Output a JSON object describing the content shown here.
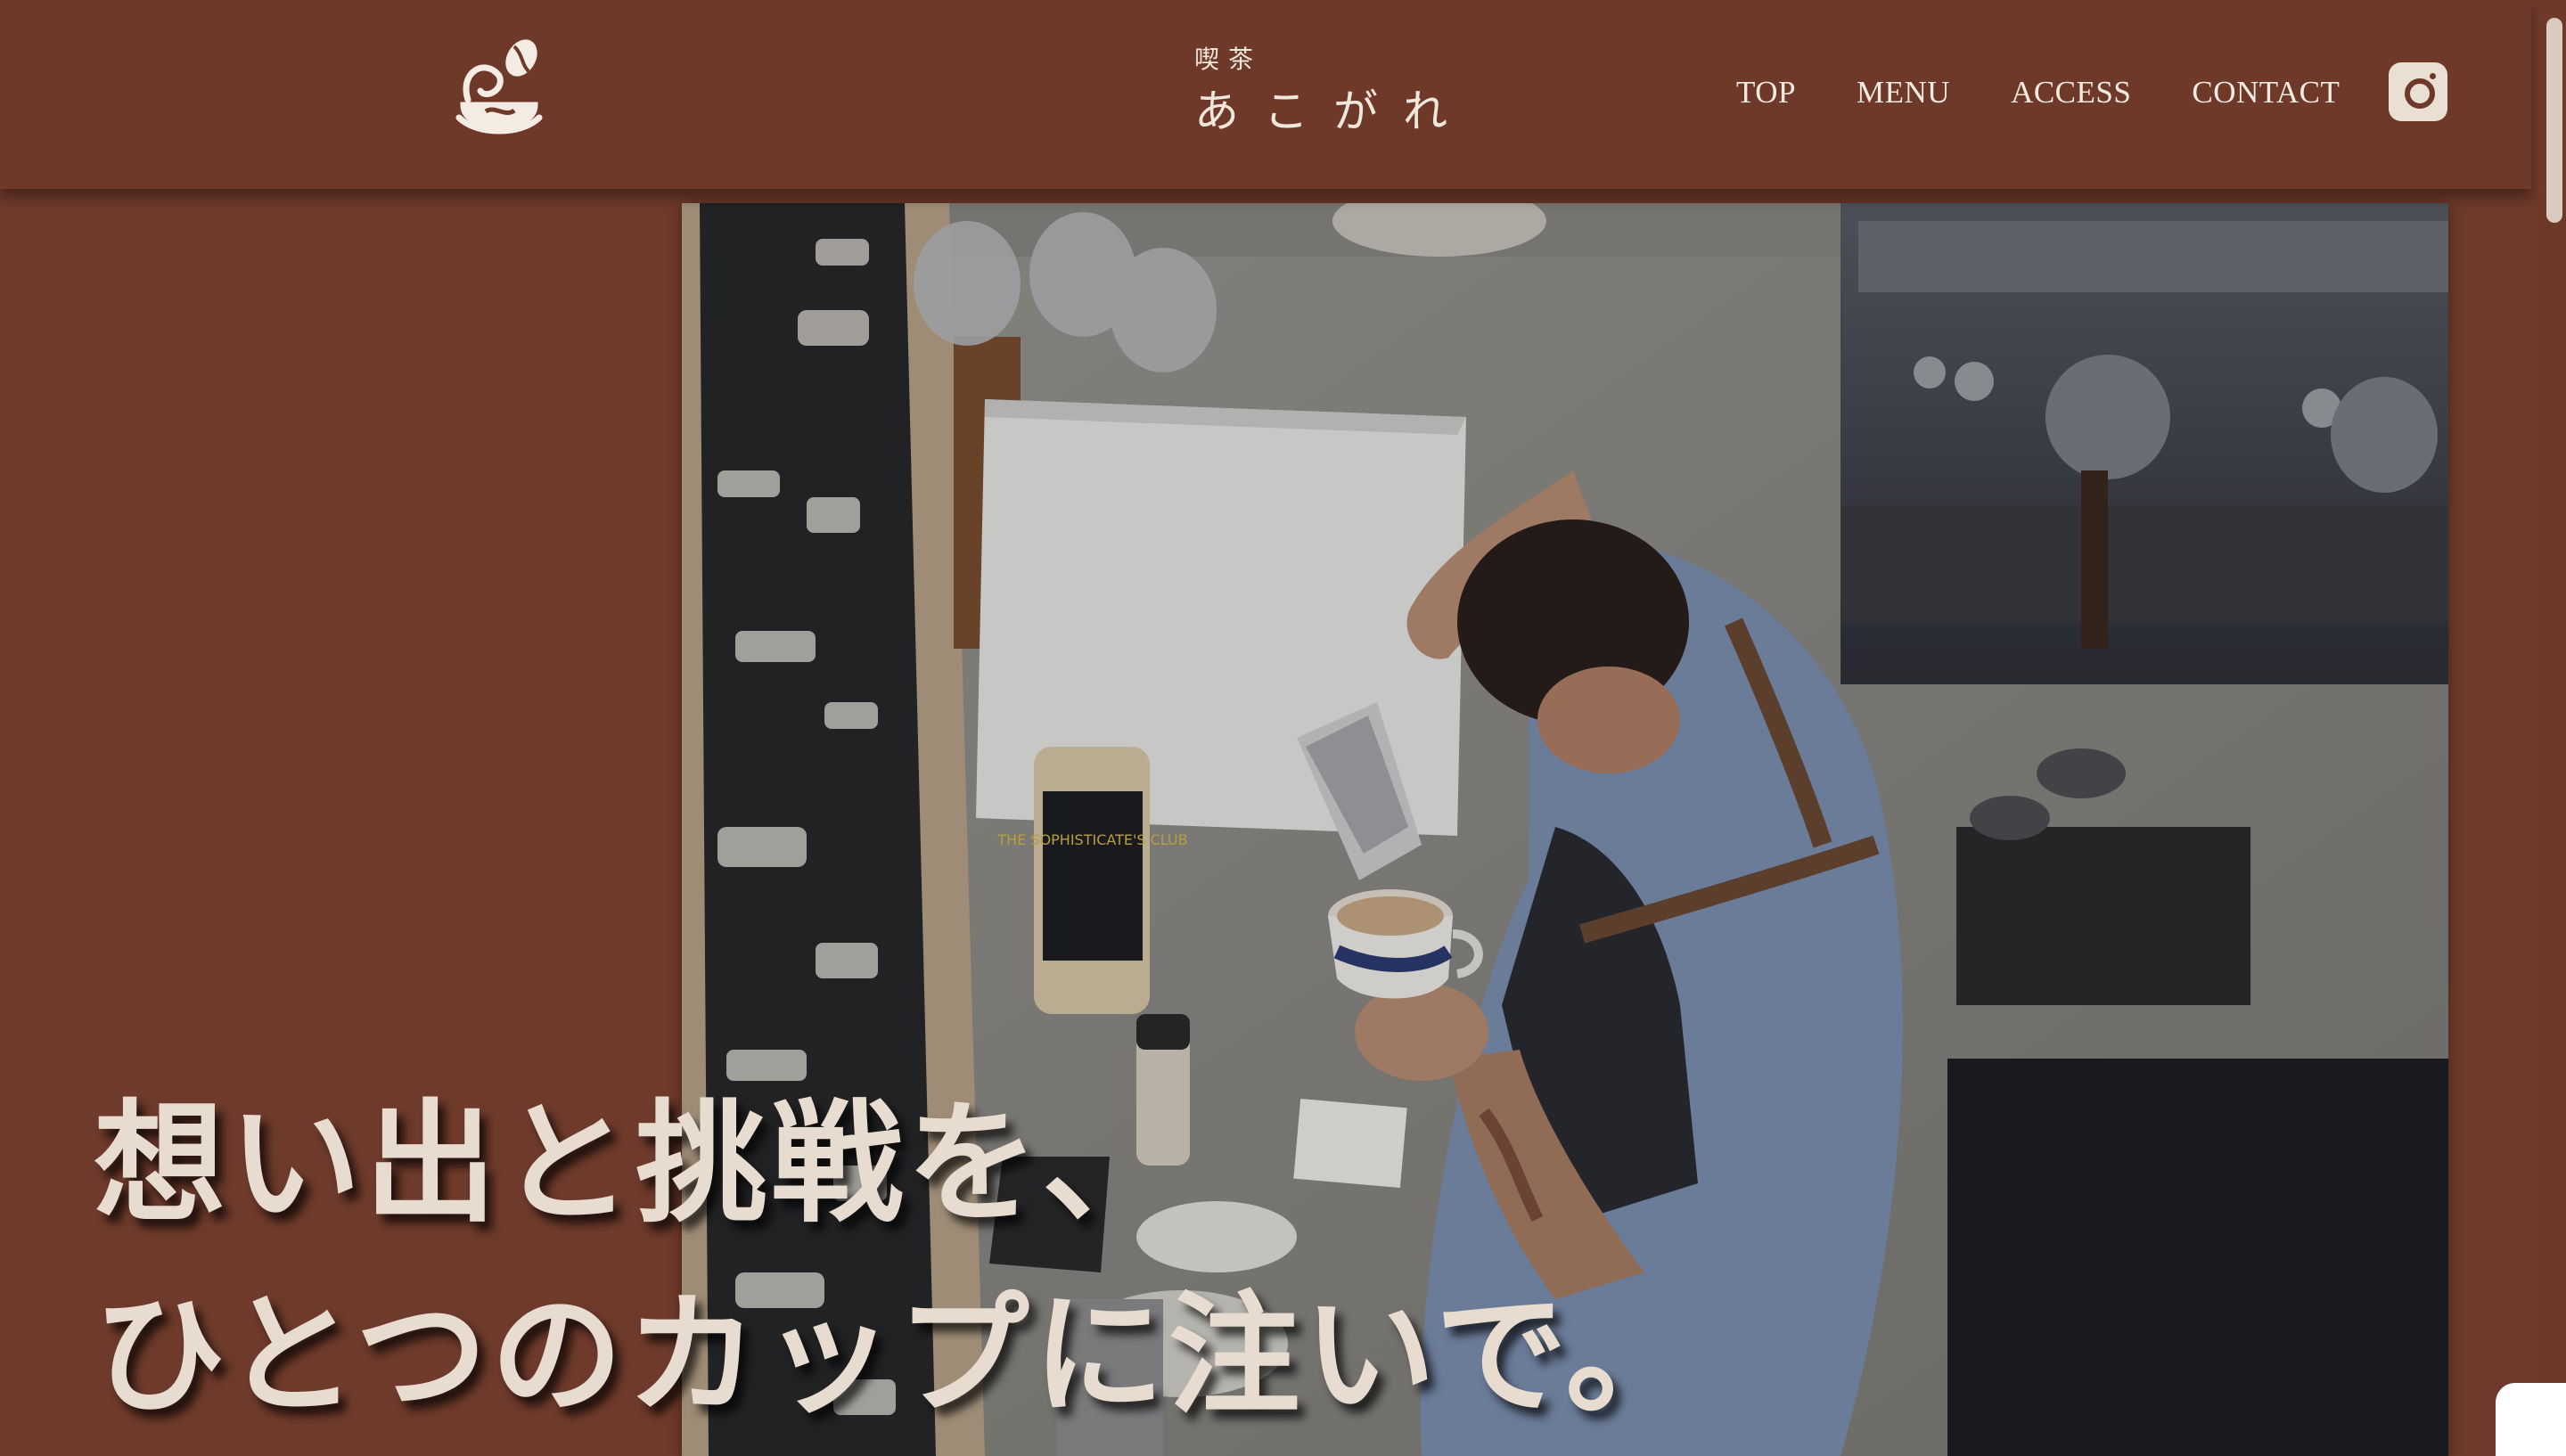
{
  "header": {
    "brand_small": "喫茶",
    "brand_main": "あこがれ",
    "nav": [
      "TOP",
      "MENU",
      "ACCESS",
      "CONTACT"
    ]
  },
  "hero": {
    "line1": "想い出と挑戦を、",
    "line2": "ひとつのカップに注いで。",
    "bottle_label": "THE SOPHISTICATE'S CLUB"
  },
  "icons": {
    "logo": "coffee-cup-bean-logo",
    "social": "instagram-icon"
  },
  "colors": {
    "background": "#6e3a2b",
    "header": "#6f392a",
    "text_light": "#efe6dc"
  }
}
